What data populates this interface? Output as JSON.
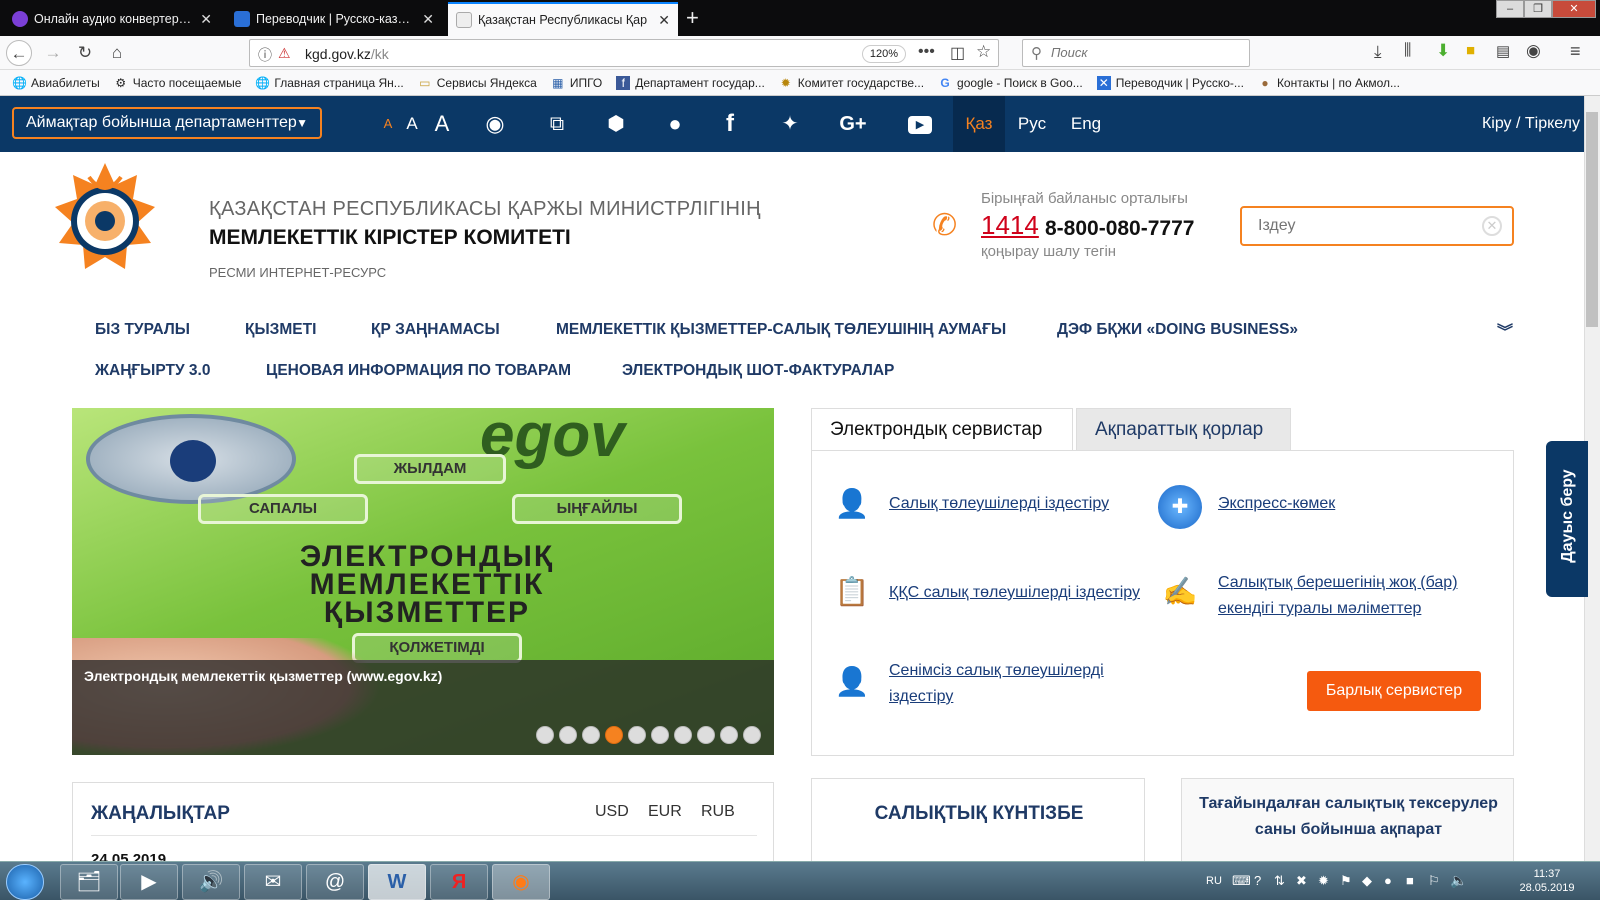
{
  "browser": {
    "tabs": [
      {
        "label": "Онлайн аудио конвертер - ко"
      },
      {
        "label": "Переводчик | Русско-казахск"
      },
      {
        "label": "Қазақстан Республикасы Қар"
      }
    ],
    "url_host": "kgd.gov.kz",
    "url_path": "/kk",
    "zoom": "120%",
    "search_placeholder": "Поиск",
    "bookmarks": [
      "Авиабилеты",
      "Часто посещаемые",
      "Главная страница Ян...",
      "Сервисы Яндекса",
      "ИПГО",
      "Департамент государ...",
      "Комитет государстве...",
      "google - Поиск в Goo...",
      "Переводчик | Русско-...",
      "Контакты | по Акмол..."
    ]
  },
  "site": {
    "region_button": "Аймақтар бойынша департаменттер",
    "font_sizes": [
      "A",
      "A",
      "A"
    ],
    "languages": [
      "Қаз",
      "Рус",
      "Eng"
    ],
    "login": "Кіру / Тіркелу",
    "org_line1": "ҚАЗАҚСТАН РЕСПУБЛИКАСЫ ҚАРЖЫ МИНИСТРЛІГІНІҢ",
    "org_line2": "МЕМЛЕКЕТТІК КІРІСТЕР КОМИТЕТІ",
    "org_line3": "РЕСМИ ИНТЕРНЕТ-РЕСУРС",
    "contact_title": "Бірыңғай байланыс орталығы",
    "contact_short": "1414",
    "contact_phone": "8-800-080-7777",
    "contact_note": "қоңырау шалу тегін",
    "search_placeholder": "Іздеу",
    "menu": [
      "БІЗ ТУРАЛЫ",
      "ҚЫЗМЕТІ",
      "ҚР ЗАҢНАМАСЫ",
      "МЕМЛЕКЕТТІК ҚЫЗМЕТТЕР-САЛЫҚ ТӨЛЕУШІНІҢ АУМАҒЫ",
      "ДЭФ БҚЖИ «DOING BUSINESS»",
      "ЖАҢҒЫРТУ 3.0",
      "ЦЕНОВАЯ ИНФОРМАЦИЯ ПО ТОВАРАМ",
      "ЭЛЕКТРОНДЫҚ ШОТ-ФАКТУРАЛАР"
    ],
    "slider": {
      "egov_text": "egov",
      "chips": [
        "ЖЫЛДАМ",
        "САПАЛЫ",
        "ЫҢҒАЙЛЫ",
        "ҚОЛЖЕТІМДІ"
      ],
      "big_text": [
        "ЭЛЕКТРОНДЫҚ",
        "МЕМЛЕКЕТТІК",
        "ҚЫЗМЕТТЕР"
      ],
      "caption": "Электрондық мемлекеттік қызметтер (www.egov.kz)",
      "dot_count": 10,
      "active_dot": 4
    },
    "service_tabs": [
      "Электрондық сервистар",
      "Ақпараттық қорлар"
    ],
    "services": [
      "Салық төлеушілерді іздестіру",
      "Экспресс-көмек",
      "ҚҚС салық төлеушілерді іздестіру",
      "Салықтық берешегінің жоқ (бар) екендігі туралы мәліметтер",
      "Сенімсіз салық төлеушілерді іздестіру"
    ],
    "all_services_button": "Барлық сервистер",
    "voice_tab": "Дауыс беру",
    "news_title": "ЖАҢАЛЫҚТАР",
    "currencies": [
      "USD",
      "EUR",
      "RUB"
    ],
    "news_date": "24.05.2019",
    "calendar_title": "САЛЫҚТЫҚ КҮНТІЗБЕ",
    "audit_title": "Тағайындалған салықтық тексерулер саны бойынша ақпарат"
  },
  "taskbar": {
    "lang": "RU",
    "time": "11:37",
    "date": "28.05.2019"
  },
  "colors": {
    "site_navy": "#0b3866",
    "accent_orange": "#f58220",
    "button_orange": "#f55a0f",
    "hotline_red": "#d0021b"
  }
}
